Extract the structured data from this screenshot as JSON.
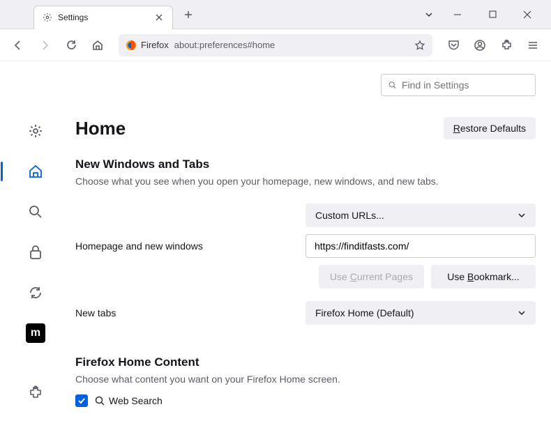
{
  "tab": {
    "title": "Settings"
  },
  "url": {
    "label": "Firefox",
    "address": "about:preferences#home"
  },
  "search": {
    "placeholder": "Find in Settings"
  },
  "page": {
    "title": "Home",
    "restore": "Restore Defaults",
    "section1": {
      "heading": "New Windows and Tabs",
      "description": "Choose what you see when you open your homepage, new windows, and new tabs."
    },
    "homepage": {
      "label": "Homepage and new windows",
      "mode": "Custom URLs...",
      "value": "https://finditfasts.com/",
      "use_current": "Use Current Pages",
      "use_bookmark": "Use Bookmark..."
    },
    "newtabs": {
      "label": "New tabs",
      "mode": "Firefox Home (Default)"
    },
    "section2": {
      "heading": "Firefox Home Content",
      "description": "Choose what content you want on your Firefox Home screen.",
      "websearch": "Web Search"
    }
  }
}
